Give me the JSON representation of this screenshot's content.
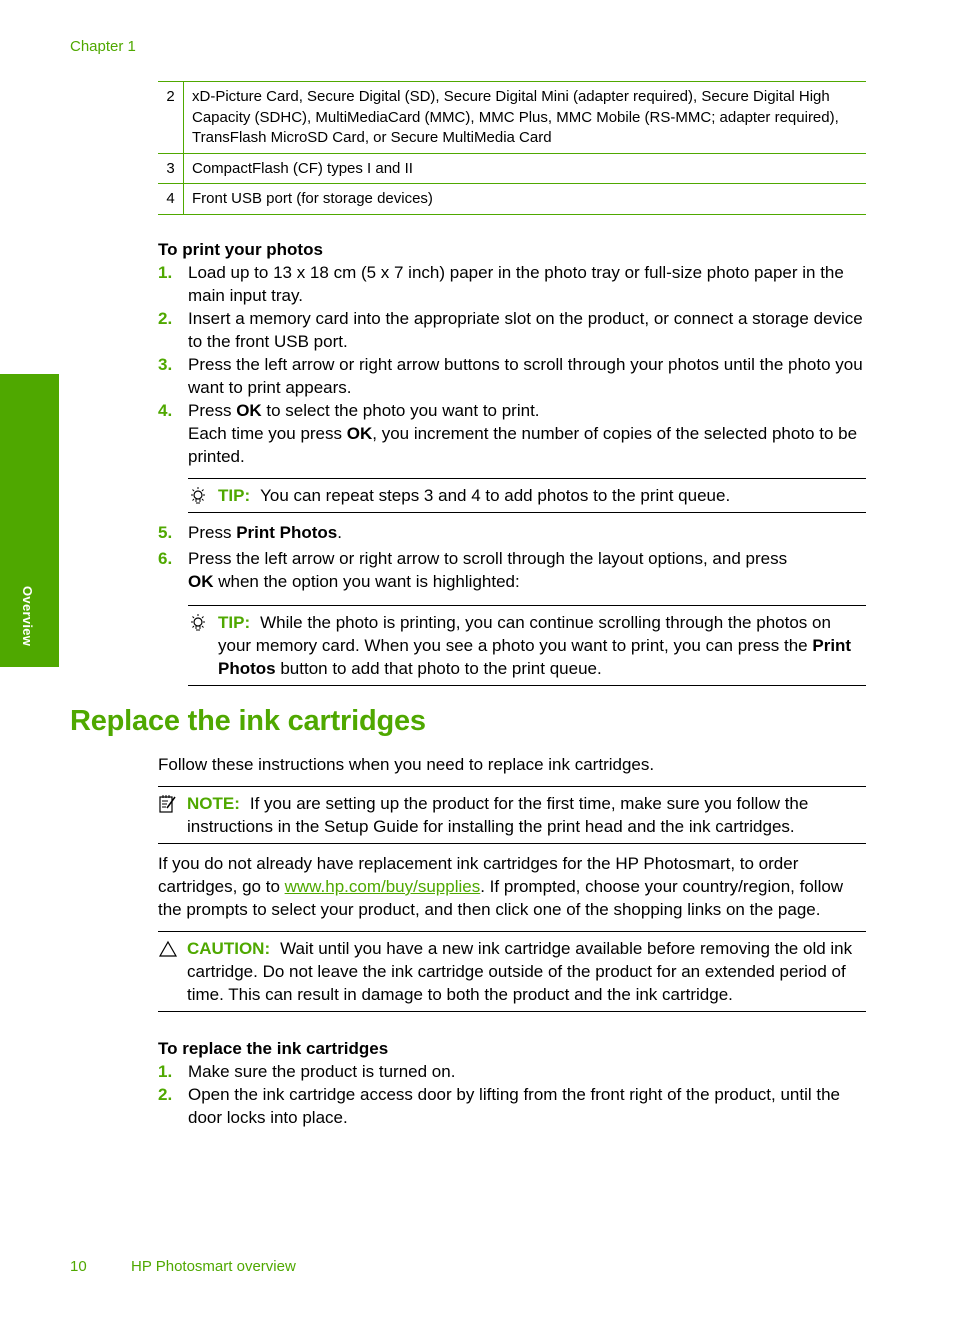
{
  "header": {
    "chapter": "Chapter 1"
  },
  "side_tab": {
    "label": "Overview"
  },
  "slots_table": {
    "rows": [
      {
        "num": "2",
        "desc": "xD-Picture Card, Secure Digital (SD), Secure Digital Mini (adapter required), Secure Digital High Capacity (SDHC), MultiMediaCard (MMC), MMC Plus, MMC Mobile (RS-MMC; adapter required), TransFlash MicroSD Card, or Secure MultiMedia Card"
      },
      {
        "num": "3",
        "desc": "CompactFlash (CF) types I and II"
      },
      {
        "num": "4",
        "desc": "Front USB port (for storage devices)"
      }
    ]
  },
  "print_photos": {
    "heading": "To print your photos",
    "steps": [
      {
        "n": "1.",
        "text": "Load up to 13 x 18 cm (5 x 7 inch) paper in the photo tray or full-size photo paper in the main input tray."
      },
      {
        "n": "2.",
        "text": "Insert a memory card into the appropriate slot on the product, or connect a storage device to the front USB port."
      },
      {
        "n": "3.",
        "text": "Press the left arrow or right arrow buttons to scroll through your photos until the photo you want to print appears."
      },
      {
        "n": "4.",
        "pre": "Press ",
        "bold": "OK",
        "post": " to select the photo you want to print.",
        "line2_pre": "Each time you press ",
        "line2_bold": "OK",
        "line2_post": ", you increment the number of copies of the selected photo to be printed."
      },
      {
        "n": "5.",
        "pre": "Press ",
        "bold": "Print Photos",
        "post": "."
      },
      {
        "n": "6.",
        "text": "Press the left arrow or right arrow to scroll through the layout options, and press",
        "bold2": "OK",
        "post2": " when the option you want is highlighted:"
      }
    ],
    "tip1": {
      "label": "TIP:",
      "text": "You can repeat steps 3 and 4 to add photos to the print queue."
    },
    "tip2": {
      "label": "TIP:",
      "text": "While the photo is printing, you can continue scrolling through the photos on your memory card. When you see a photo you want to print, you can press the ",
      "bold": "Print Photos",
      "post": " button to add that photo to the print queue."
    }
  },
  "replace_section": {
    "title": "Replace the ink cartridges",
    "intro": "Follow these instructions when you need to replace ink cartridges.",
    "note": {
      "label": "NOTE:",
      "text": "If you are setting up the product for the first time, make sure you follow the instructions in the Setup Guide for installing the print head and the ink cartridges."
    },
    "order_para": {
      "pre": "If you do not already have replacement ink cartridges for the HP Photosmart, to order cartridges, go to ",
      "link": "www.hp.com/buy/supplies",
      "post": ". If prompted, choose your country/region, follow the prompts to select your product, and then click one of the shopping links on the page."
    },
    "caution": {
      "label": "CAUTION:",
      "text": "Wait until you have a new ink cartridge available before removing the old ink cartridge. Do not leave the ink cartridge outside of the product for an extended period of time. This can result in damage to both the product and the ink cartridge."
    },
    "procedure_heading": "To replace the ink cartridges",
    "steps": [
      {
        "n": "1.",
        "text": "Make sure the product is turned on."
      },
      {
        "n": "2.",
        "text": "Open the ink cartridge access door by lifting from the front right of the product, until the door locks into place."
      }
    ]
  },
  "footer": {
    "page_number": "10",
    "section": "HP Photosmart overview"
  },
  "colors": {
    "accent": "#4fa800"
  }
}
